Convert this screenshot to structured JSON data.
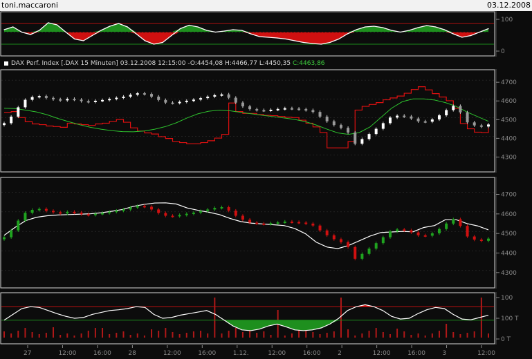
{
  "header": {
    "user": "toni.maccaroni",
    "date": "03.12.2008"
  },
  "legend": {
    "name": "DAX Perf. Index",
    "symbol": "[.DAX",
    "interval": "15 Minuten]",
    "datetime": "03.12.2008 12:15:00",
    "open": "-O:4454,08",
    "high": "H:4466,77",
    "low": "L:4450,35",
    "close": "C:4463,86"
  },
  "colors": {
    "up": "#1fa31f",
    "down": "#d01010",
    "ma": "#2ec22e",
    "stop": "#e01010",
    "line": "#ffffff",
    "grid": "#3a3a3a"
  },
  "chart_data": [
    {
      "type": "area",
      "panel": "oscillator-top",
      "yticks": [
        "100",
        "0"
      ],
      "ylim": [
        0,
        100
      ],
      "series": [
        {
          "values": [
            62,
            70,
            55,
            48,
            60,
            82,
            76,
            55,
            35,
            30,
            45,
            60,
            72,
            80,
            70,
            50,
            30,
            20,
            25,
            45,
            65,
            75,
            70,
            60,
            55,
            58,
            62,
            60,
            50,
            42,
            40,
            38,
            35,
            30,
            25,
            22,
            20,
            25,
            35,
            50,
            62,
            70,
            72,
            68,
            60,
            55,
            60,
            68,
            74,
            70,
            62,
            50,
            40,
            45,
            55,
            65
          ]
        }
      ]
    },
    {
      "type": "candlestick",
      "panel": "price-main",
      "yticks": [
        "4700",
        "4600",
        "4500",
        "4400",
        "4300"
      ],
      "ylim": [
        4250,
        4730
      ],
      "close": [
        4470,
        4505,
        4555,
        4595,
        4610,
        4615,
        4605,
        4598,
        4592,
        4600,
        4596,
        4588,
        4584,
        4590,
        4594,
        4600,
        4606,
        4612,
        4622,
        4630,
        4626,
        4612,
        4594,
        4580,
        4578,
        4584,
        4590,
        4596,
        4604,
        4612,
        4620,
        4624,
        4606,
        4580,
        4560,
        4545,
        4540,
        4538,
        4542,
        4546,
        4550,
        4548,
        4545,
        4540,
        4530,
        4505,
        4480,
        4460,
        4445,
        4420,
        4360,
        4385,
        4412,
        4440,
        4470,
        4500,
        4510,
        4506,
        4495,
        4480,
        4478,
        4490,
        4512,
        4540,
        4562,
        4528,
        4474,
        4458,
        4452,
        4463
      ],
      "stop": [
        4528,
        4532,
        4500,
        4478,
        4466,
        4462,
        4455,
        4452,
        4448,
        4470,
        4466,
        4462,
        4458,
        4466,
        4470,
        4480,
        4490,
        4475,
        4445,
        4428,
        4418,
        4412,
        4398,
        4388,
        4372,
        4366,
        4360,
        4360,
        4366,
        4376,
        4390,
        4410,
        4578,
        4532,
        4522,
        4522,
        4516,
        4512,
        4510,
        4506,
        4502,
        4500,
        4486,
        4470,
        4450,
        4420,
        4338,
        4338,
        4338,
        4372,
        4540,
        4560,
        4570,
        4580,
        4595,
        4605,
        4615,
        4630,
        4650,
        4665,
        4648,
        4628,
        4610,
        4590,
        4550,
        4468,
        4440,
        4422,
        4420,
        4448
      ],
      "ma": [
        4550,
        4548,
        4540,
        4530,
        4515,
        4495,
        4478,
        4462,
        4448,
        4438,
        4430,
        4425,
        4424,
        4428,
        4438,
        4452,
        4472,
        4498,
        4520,
        4534,
        4540,
        4536,
        4528,
        4520,
        4512,
        4505,
        4498,
        4490,
        4478,
        4460,
        4438,
        4418,
        4410,
        4420,
        4450,
        4500,
        4550,
        4585,
        4600,
        4600,
        4594,
        4580,
        4560,
        4530,
        4505,
        4480
      ]
    },
    {
      "type": "candlestick",
      "panel": "price-second",
      "yticks": [
        "4700",
        "4600",
        "4500",
        "4400",
        "4300"
      ],
      "ylim": [
        4250,
        4730
      ],
      "band": [
        4480,
        4520,
        4555,
        4572,
        4580,
        4584,
        4586,
        4588,
        4590,
        4595,
        4603,
        4612,
        4628,
        4638,
        4645,
        4646,
        4640,
        4620,
        4608,
        4598,
        4586,
        4566,
        4550,
        4542,
        4538,
        4534,
        4530,
        4515,
        4488,
        4445,
        4420,
        4412,
        4428,
        4452,
        4476,
        4494,
        4497,
        4500,
        4498,
        4520,
        4530,
        4560,
        4560,
        4540,
        4528,
        4508
      ]
    },
    {
      "type": "area",
      "panel": "indicator-bottom",
      "yticks": [
        "100",
        "100 T",
        "0 T"
      ],
      "ylim": [
        0,
        100
      ],
      "series": [
        {
          "values": [
            45,
            60,
            75,
            80,
            78,
            70,
            62,
            55,
            50,
            52,
            60,
            65,
            70,
            72,
            75,
            80,
            78,
            60,
            50,
            52,
            58,
            62,
            66,
            70,
            60,
            45,
            30,
            20,
            18,
            22,
            30,
            35,
            28,
            20,
            18,
            20,
            25,
            35,
            50,
            70,
            80,
            85,
            80,
            70,
            55,
            48,
            50,
            62,
            72,
            78,
            75,
            60,
            48,
            46,
            52,
            58
          ]
        }
      ]
    }
  ],
  "time_axis": [
    "27",
    "12:00",
    "16:00",
    "28",
    "12:00",
    "16:00",
    "1.12.",
    "12:00",
    "16:00",
    "2",
    "12:00",
    "16:00",
    "3",
    "12:00"
  ]
}
